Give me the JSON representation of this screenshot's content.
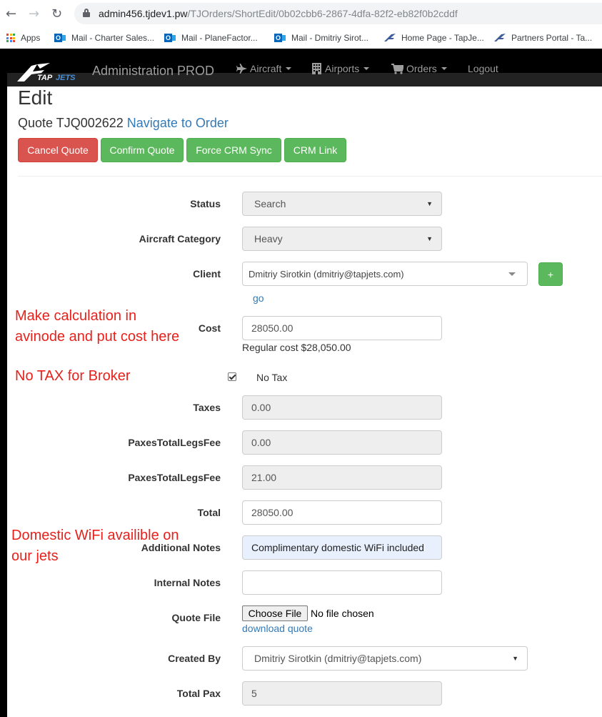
{
  "browser": {
    "url_host": "admin456.tjdev1.pw",
    "url_path": "/TJOrders/ShortEdit/0b02cbb6-2867-4dfa-82f2-eb82f0b2cddf",
    "bookmarks": [
      {
        "label": "Apps",
        "icon": "apps-grid-icon"
      },
      {
        "label": "Mail - Charter Sales...",
        "icon": "outlook-icon"
      },
      {
        "label": "Mail - PlaneFactor...",
        "icon": "outlook-icon"
      },
      {
        "label": "Mail - Dmitriy Sirot...",
        "icon": "outlook-icon"
      },
      {
        "label": "Home Page - TapJe...",
        "icon": "tapjets-icon"
      },
      {
        "label": "Partners Portal - Ta...",
        "icon": "tapjets-icon"
      }
    ]
  },
  "navbar": {
    "logo_text": "TAPJETS",
    "brand": "Administration PROD",
    "items": [
      {
        "label": "Aircraft",
        "icon": "plane-icon"
      },
      {
        "label": "Airports",
        "icon": "building-icon"
      },
      {
        "label": "Orders",
        "icon": "cart-icon"
      },
      {
        "label": "Logout"
      }
    ]
  },
  "page": {
    "title": "Edit",
    "quote_prefix": "Quote TJQ002622",
    "navigate_link": "Navigate to Order",
    "buttons": {
      "cancel": "Cancel Quote",
      "confirm": "Confirm Quote",
      "crm_sync": "Force CRM Sync",
      "crm_link": "CRM Link"
    }
  },
  "form": {
    "status": {
      "label": "Status",
      "value": "Search"
    },
    "aircraft_category": {
      "label": "Aircraft Category",
      "value": "Heavy"
    },
    "client": {
      "label": "Client",
      "value": "Dmitriy Sirotkin (dmitriy@tapjets.com)",
      "go": "go",
      "add": "+"
    },
    "cost": {
      "label": "Cost",
      "value": "28050.00",
      "help": "Regular cost $28,050.00"
    },
    "no_tax": {
      "label": "No Tax",
      "checked": true
    },
    "taxes": {
      "label": "Taxes",
      "value": "0.00"
    },
    "paxes_fee_1": {
      "label": "PaxesTotalLegsFee",
      "value": "0.00"
    },
    "paxes_fee_2": {
      "label": "PaxesTotalLegsFee",
      "value": "21.00"
    },
    "total": {
      "label": "Total",
      "value": "28050.00"
    },
    "additional_notes": {
      "label": "Additional Notes",
      "value": "Complimentary domestic WiFi included"
    },
    "internal_notes": {
      "label": "Internal Notes",
      "value": ""
    },
    "quote_file": {
      "label": "Quote File",
      "button": "Choose File",
      "status": "No file chosen",
      "download": "download quote"
    },
    "created_by": {
      "label": "Created By",
      "value": "Dmitriy Sirotkin (dmitriy@tapjets.com)"
    },
    "total_pax": {
      "label": "Total Pax",
      "value": "5"
    }
  },
  "annotations": {
    "cost_line1": "Make calculation in",
    "cost_line2": "avinode and put cost here",
    "tax": "No TAX for Broker",
    "wifi_line1": "Domestic WiFi availible on",
    "wifi_line2": "our jets"
  },
  "colors": {
    "annotation": "#e8211c",
    "danger": "#d9534f",
    "success": "#5cb85c",
    "link": "#337ab7",
    "apps_grid": [
      "#ea4335",
      "#fbbc05",
      "#34a853",
      "#4285f4"
    ]
  }
}
